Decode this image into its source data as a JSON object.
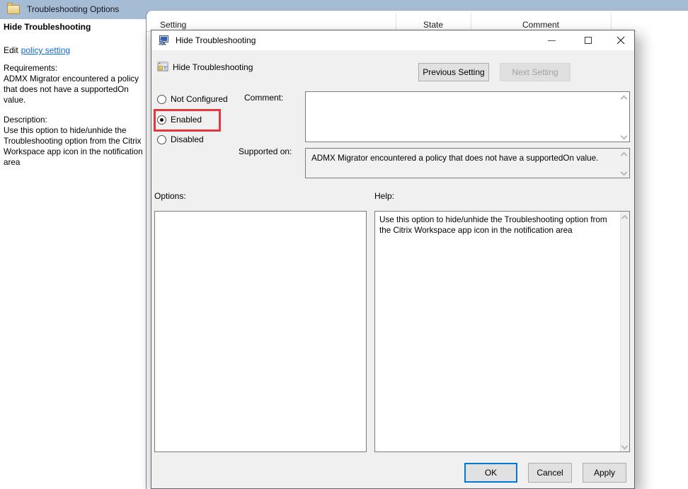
{
  "background": {
    "folder_title": "Troubleshooting Options",
    "columns": {
      "setting": "Setting",
      "state": "State",
      "comment": "Comment"
    },
    "left_pane": {
      "title": "Hide Troubleshooting",
      "edit_prefix": "Edit",
      "edit_link": "policy setting",
      "requirements_label": "Requirements:",
      "requirements_text": "ADMX Migrator encountered a policy that does not have a supportedOn value.",
      "description_label": "Description:",
      "description_text": "Use this option to hide/unhide the Troubleshooting option from the Citrix Workspace app icon in the notification area"
    }
  },
  "dialog": {
    "title": "Hide Troubleshooting",
    "setting_name": "Hide Troubleshooting",
    "previous_setting": "Previous Setting",
    "next_setting": "Next Setting",
    "radios": {
      "not_configured": "Not Configured",
      "enabled": "Enabled",
      "disabled": "Disabled"
    },
    "selected_radio": "Enabled",
    "comment_label": "Comment:",
    "comment_value": "",
    "supported_on_label": "Supported on:",
    "supported_on_value": "ADMX Migrator encountered a policy that does not have a supportedOn value.",
    "options_label": "Options:",
    "help_label": "Help:",
    "help_text": "Use this option to hide/unhide the Troubleshooting option from the Citrix Workspace app icon in the notification area",
    "ok_label": "OK",
    "cancel_label": "Cancel",
    "apply_label": "Apply"
  },
  "colors": {
    "header_strip": "#a6bcd4",
    "highlight_red": "#e5383e",
    "focus_blue": "#0078d7",
    "link_blue": "#0b6cd6",
    "dialog_bg": "#f0f0f0"
  }
}
